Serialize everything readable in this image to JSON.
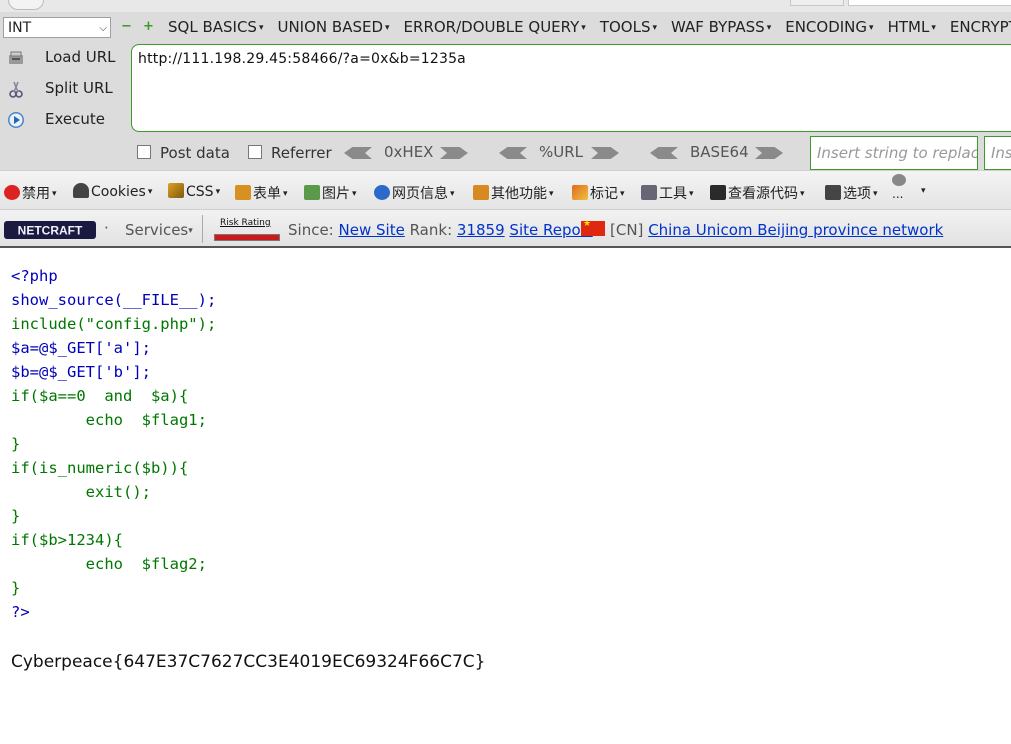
{
  "hackbar": {
    "type_select": "INT",
    "plus_symbol": "+",
    "minus_symbol": "−",
    "menus": [
      "SQL BASICS",
      "UNION BASED",
      "ERROR/DOUBLE QUERY",
      "TOOLS",
      "WAF BYPASS",
      "ENCODING",
      "HTML",
      "ENCRYPT"
    ],
    "load_url": "Load URL",
    "split_url": "Split URL",
    "execute": "Execute",
    "url_value": "http://111.198.29.45:58466/?a=0x&b=1235a",
    "post_data": "Post data",
    "referrer": "Referrer",
    "hex": "0xHEX",
    "url_enc": "%URL",
    "base64": "BASE64",
    "replace_placeholder": "Insert string to replace",
    "replace_with_placeholder": "Insert replacing string"
  },
  "toolbar2": {
    "items": [
      "禁用",
      "Cookies",
      "CSS",
      "表单",
      "图片",
      "网页信息",
      "其他功能",
      "标记",
      "工具",
      "查看源代码",
      "选项"
    ],
    "ellipsis": "..."
  },
  "netcraft": {
    "logo": "NETCRAFT",
    "services": "Services",
    "risk_rating": "Risk Rating",
    "since_label": "Since:",
    "since_value": "New Site",
    "rank_label": "Rank:",
    "rank_value": "31859",
    "site_report": "Site Report",
    "country": "[CN]",
    "network": "China Unicom Beijing province network"
  },
  "code": {
    "lines": [
      "<?php",
      "show_source(__FILE__);",
      "include(\"config.php\");",
      "$a=@$_GET['a'];",
      "$b=@$_GET['b'];",
      "if($a==0  and  $a){",
      "        echo  $flag1;",
      "}",
      "if(is_numeric($b)){",
      "        exit();",
      "}",
      "if($b>1234){",
      "        echo  $flag2;",
      "}",
      "?>"
    ]
  },
  "output": {
    "flag": "Cyberpeace{647E37C7627CC3E4019EC69324F66C7C}"
  }
}
